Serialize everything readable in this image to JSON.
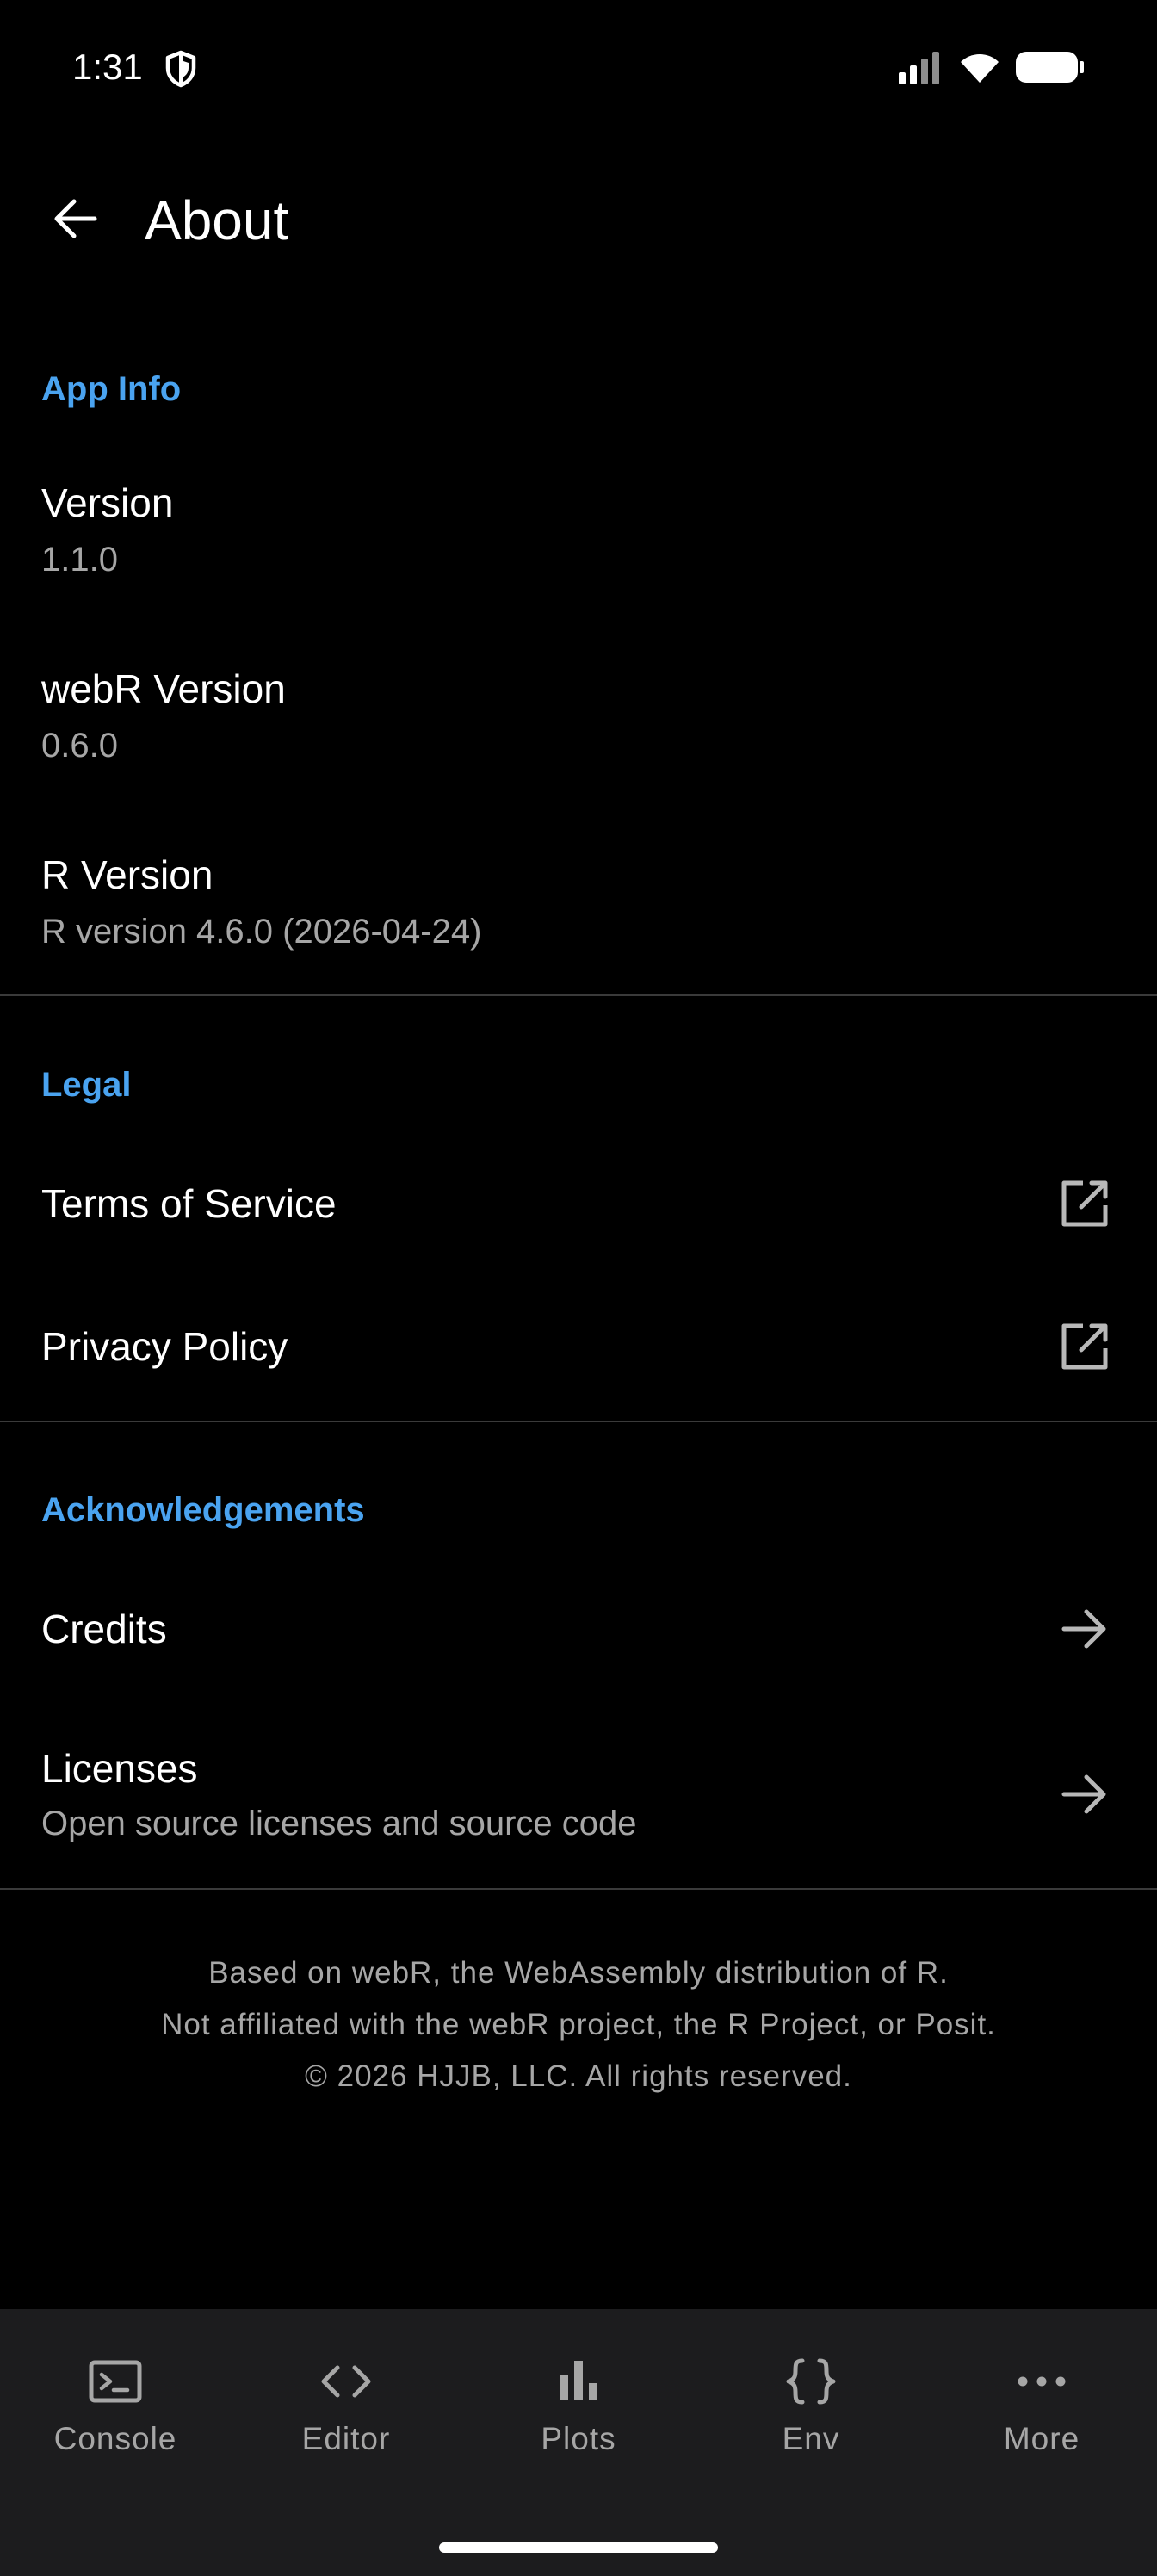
{
  "status_bar": {
    "time": "1:31",
    "icons": [
      "shield-icon",
      "signal-icon",
      "wifi-icon",
      "battery-icon"
    ]
  },
  "app_bar": {
    "title": "About",
    "back_icon": "arrow-back-icon"
  },
  "sections": {
    "app_info": {
      "header": "App Info",
      "version": {
        "title": "Version",
        "value": "1.1.0"
      },
      "webr_version": {
        "title": "webR Version",
        "value": "0.6.0"
      },
      "r_version": {
        "title": "R Version",
        "value": "R version 4.6.0 (2026-04-24)"
      }
    },
    "legal": {
      "header": "Legal",
      "terms": {
        "title": "Terms of Service",
        "icon": "open-in-new-icon"
      },
      "privacy": {
        "title": "Privacy Policy",
        "icon": "open-in-new-icon"
      }
    },
    "acknowledgements": {
      "header": "Acknowledgements",
      "credits": {
        "title": "Credits",
        "icon": "arrow-forward-icon"
      },
      "licenses": {
        "title": "Licenses",
        "summary": "Open source licenses and source code",
        "icon": "arrow-forward-icon"
      }
    }
  },
  "footer": {
    "line1": "Based on webR, the WebAssembly distribution of R.",
    "line2": "Not affiliated with the webR project, the R Project, or Posit.",
    "line3": "© 2026 HJJB, LLC. All rights reserved."
  },
  "bottom_nav": {
    "items": [
      {
        "label": "Console",
        "icon": "terminal-icon"
      },
      {
        "label": "Editor",
        "icon": "code-icon"
      },
      {
        "label": "Plots",
        "icon": "bar-chart-icon"
      },
      {
        "label": "Env",
        "icon": "braces-icon"
      },
      {
        "label": "More",
        "icon": "more-horiz-icon"
      }
    ]
  },
  "colors": {
    "background": "#000000",
    "accent": "#4aa3f0",
    "text_primary": "#ffffff",
    "text_secondary": "#a6a6a6",
    "nav_background": "#1c1c1e"
  }
}
